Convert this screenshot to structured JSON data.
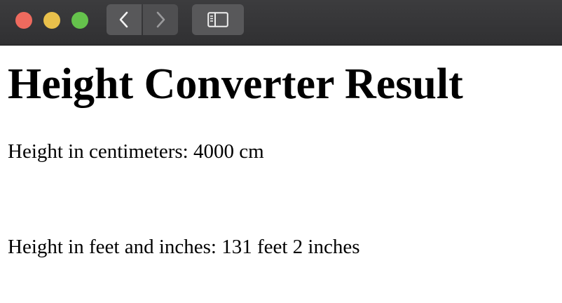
{
  "browser": {
    "traffic_lights": {
      "close_color": "#ee6a5e",
      "minimize_color": "#e9c04b",
      "zoom_color": "#65c24c"
    },
    "toolbar": {
      "back_icon": "chevron-left-icon",
      "forward_icon": "chevron-right-icon",
      "sidebar_icon": "sidebar-icon"
    }
  },
  "page": {
    "title": "Height Converter Result",
    "centimeters_text": "Height in centimeters: 4000 cm",
    "feet_inches_text": "Height in feet and inches: 131 feet 2 inches"
  }
}
